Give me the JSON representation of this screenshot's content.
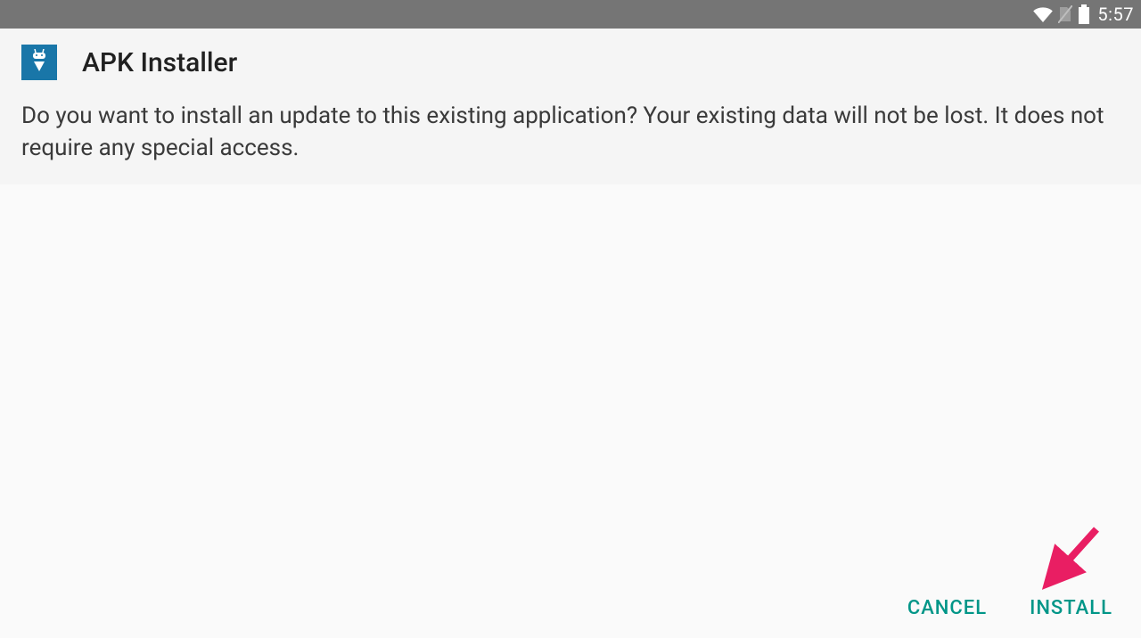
{
  "status_bar": {
    "time": "5:57"
  },
  "dialog": {
    "app_name": "APK Installer",
    "message": "Do you want to install an update to this existing application? Your existing data will not be lost. It does not require any special access."
  },
  "buttons": {
    "cancel": "CANCEL",
    "install": "INSTALL"
  }
}
